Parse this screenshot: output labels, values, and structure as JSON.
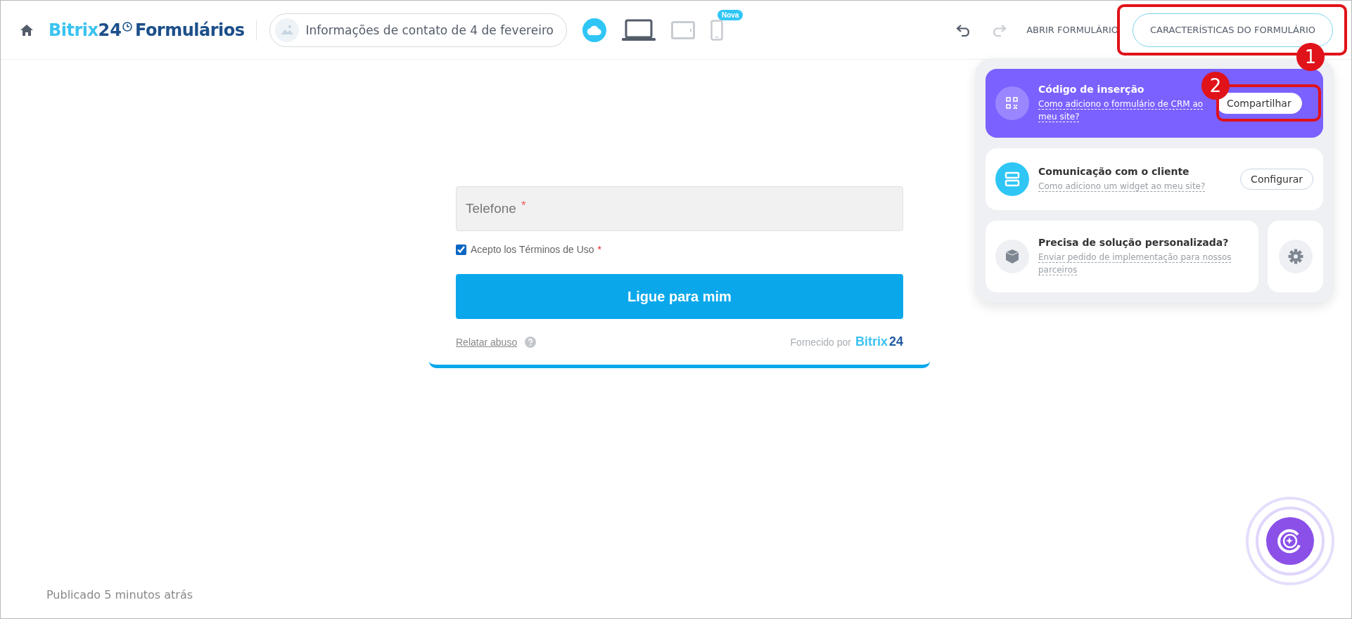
{
  "header": {
    "logo": {
      "brand": "Bitrix",
      "brand_number": "24",
      "product": "Formulários"
    },
    "form_title": "Informações de contato de 4 de fevereiro",
    "devices": [
      {
        "kind": "laptop",
        "selected": true
      },
      {
        "kind": "tablet",
        "selected": false
      },
      {
        "kind": "phone",
        "selected": false,
        "badge": "Nova"
      }
    ],
    "undo": {
      "disabled": false
    },
    "redo": {
      "disabled": true
    },
    "open_form": "ABRIR FORMULÁRIO",
    "features_button": "CARACTERÍSTICAS DO FORMULÁRIO"
  },
  "annotations": [
    {
      "number": "1"
    },
    {
      "number": "2"
    }
  ],
  "panel": {
    "cards": [
      {
        "kind": "embed",
        "title": "Código de inserção",
        "link": "Como adiciono o formulário de CRM ao meu site?",
        "button": "Compartilhar"
      },
      {
        "kind": "widget",
        "title": "Comunicação com o cliente",
        "link": "Como adiciono um widget ao meu site?",
        "button": "Configurar"
      },
      {
        "kind": "custom",
        "title": "Precisa de solução personalizada?",
        "link": "Enviar pedido de implementação para nossos parceiros"
      }
    ]
  },
  "form": {
    "phone": {
      "placeholder": "Telefone",
      "required_mark": "*"
    },
    "terms": {
      "label": "Acepto los Términos de Uso",
      "required_mark": "*",
      "checked": true
    },
    "submit": "Ligue para mim",
    "report_link": "Relatar abuso",
    "powered_by": "Fornecido por",
    "powered_brand": "Bitrix",
    "powered_number": "24"
  },
  "status": "Publicado 5 minutos atrás"
}
